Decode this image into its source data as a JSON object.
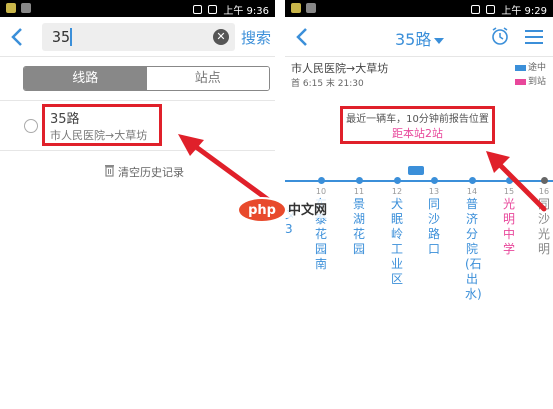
{
  "left_screen": {
    "status_time": "上午 9:36",
    "search": {
      "value": "35",
      "button": "搜索"
    },
    "tabs": [
      "线路",
      "站点"
    ],
    "history": [
      {
        "title": "35路",
        "subtitle": "市人民医院→大草坊"
      }
    ],
    "clear_history": "清空历史记录"
  },
  "right_screen": {
    "status_time": "上午 9:29",
    "title": "35路",
    "line_direction": "市人民医院→大草坊",
    "line_hours": "首 6:15  末 21:30",
    "legend": [
      "途中",
      "到站"
    ],
    "nearest_bus": "最近一辆车，10分钟前报告位置",
    "distance": "距本站2站",
    "stops": [
      {
        "num": "10",
        "name": "东泰花园南"
      },
      {
        "num": "11",
        "name": "景湖花园"
      },
      {
        "num": "12",
        "name": "犬眠岭工业区"
      },
      {
        "num": "13",
        "name": "同沙路口"
      },
      {
        "num": "14",
        "name": "普济分院(石出水)"
      },
      {
        "num": "15",
        "name": "光明中学"
      },
      {
        "num": "16",
        "name": "同沙光明"
      }
    ],
    "partial_stop_text": "文3"
  },
  "watermark": {
    "logo": "php",
    "site": "中文网"
  },
  "colors": {
    "accent": "#3b8fd9",
    "highlight": "#e8479b",
    "annotation": "#e0202a"
  }
}
